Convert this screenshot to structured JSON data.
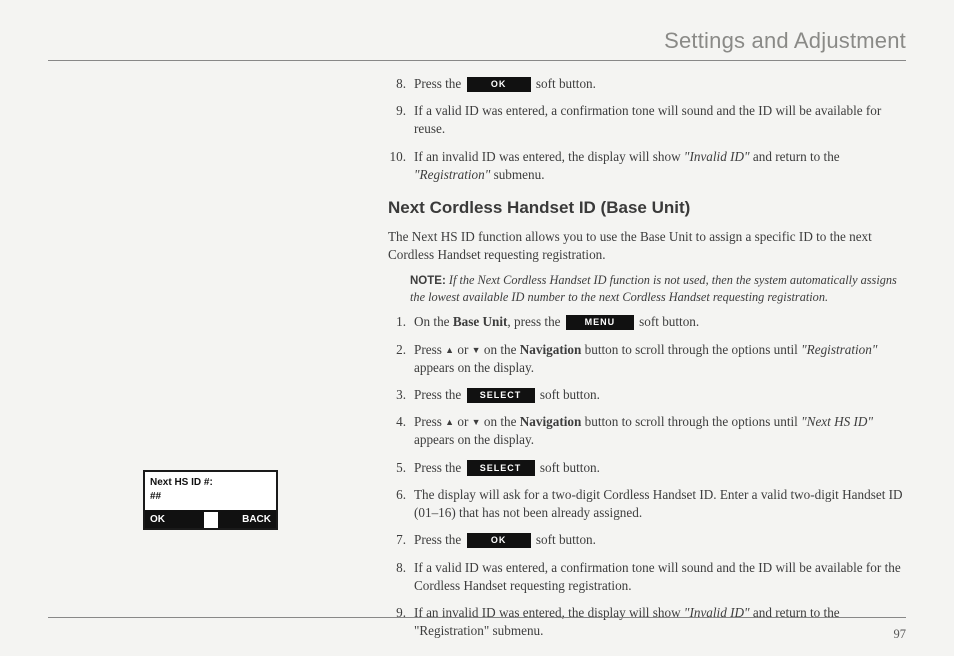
{
  "header": {
    "title": "Settings and Adjustment"
  },
  "displayBox": {
    "line1": "Next HS ID #:",
    "line2": "##",
    "ok": "OK",
    "back": "BACK"
  },
  "buttons": {
    "ok": "OK",
    "menu": "MENU",
    "select": "SELECT"
  },
  "topList": {
    "item8_pre": "Press the ",
    "item8_post": " soft button.",
    "item9": "If a valid ID was entered, a confirmation tone will sound and the ID will be available for reuse.",
    "item10_a": "If an invalid ID was entered, the display will show ",
    "item10_b": "\"Invalid ID\"",
    "item10_c": " and return to the ",
    "item10_d": "\"Registration\"",
    "item10_e": " submenu."
  },
  "section": {
    "heading": "Next Cordless Handset ID (Base Unit)",
    "intro": "The Next HS ID function allows you to use the Base Unit to assign a specific ID to the next Cordless Handset requesting registration.",
    "noteLabel": "NOTE:",
    "noteText": " If the Next  Cordless Handset ID function is not used, then the system automatically assigns the lowest available ID number to the next Cordless Handset requesting registration."
  },
  "steps": {
    "s1_a": "On the ",
    "s1_b": "Base Unit",
    "s1_c": ", press the ",
    "s1_d": " soft button.",
    "s2_a": "Press ",
    "s2_or": "  or  ",
    "s2_b": " on the ",
    "s2_nav": "Navigation",
    "s2_c": " button to scroll through the options until ",
    "s2_d": "\"Registration\"",
    "s2_e": " appears on the display.",
    "s3_a": "Press the ",
    "s3_b": " soft button.",
    "s4_a": "Press ",
    "s4_b": " on the ",
    "s4_c": " button to scroll through the options until ",
    "s4_d": "\"Next HS ID\"",
    "s4_e": " appears on the display.",
    "s5_a": "Press the ",
    "s5_b": " soft button.",
    "s6": "The display will ask for a two-digit Cordless Handset ID. Enter a valid two-digit Handset ID (01–16) that has not been already assigned.",
    "s7_a": "Press the ",
    "s7_b": " soft button.",
    "s8": "If a valid ID was entered, a confirmation tone will sound and the ID will be available for the Cordless Handset requesting registration.",
    "s9_a": "If an invalid ID was entered, the display will show ",
    "s9_b": "\"Invalid ID\"",
    "s9_c": " and return to the \"Registration\" submenu."
  },
  "pageNumber": "97"
}
